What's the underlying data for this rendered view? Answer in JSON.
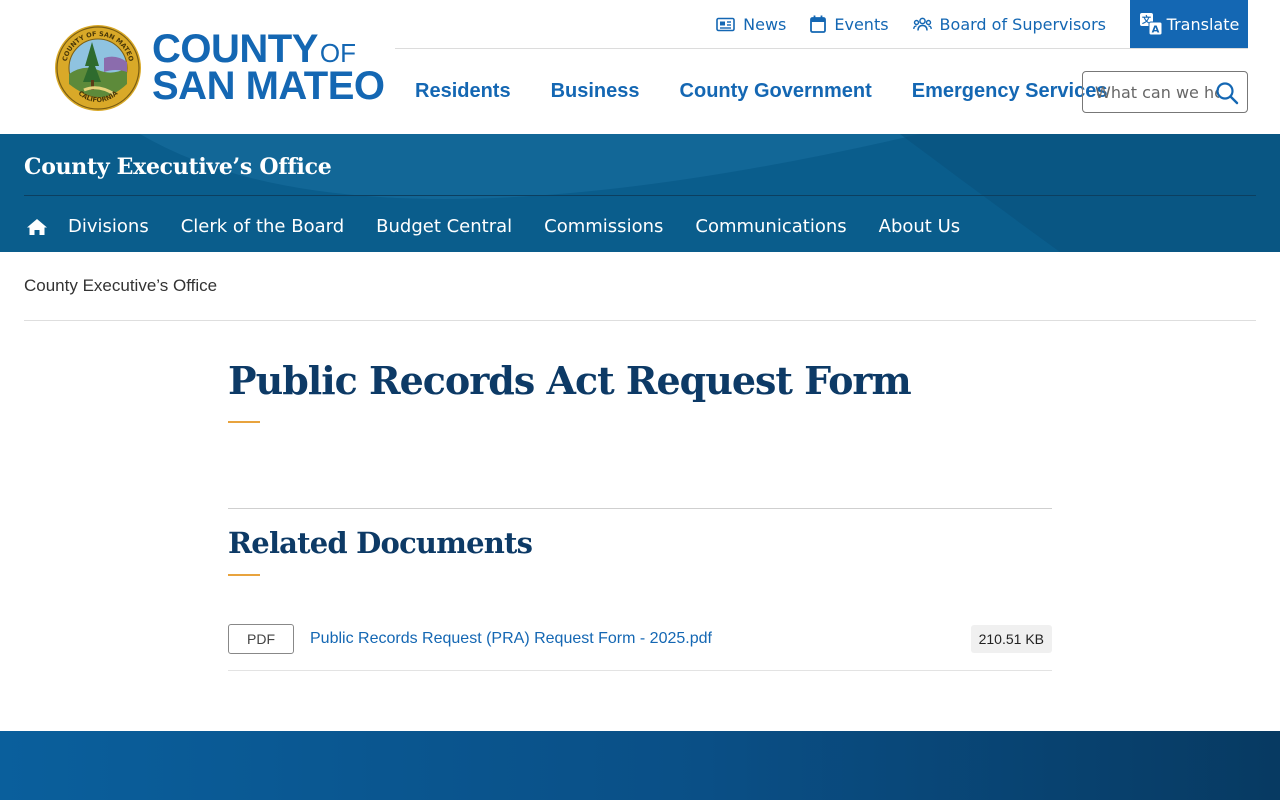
{
  "header": {
    "logo": {
      "line1": "COUNTY",
      "line1_suffix": "OF",
      "line2": "SAN MATEO",
      "seal_text_top": "COUNTY OF SAN MATEO",
      "seal_text_bottom": "CALIFORNIA"
    },
    "utility": {
      "news": "News",
      "events": "Events",
      "board": "Board of Supervisors",
      "translate": "Translate"
    },
    "nav": [
      "Residents",
      "Business",
      "County Government",
      "Emergency Services"
    ],
    "search": {
      "placeholder": "What can we help you find?"
    }
  },
  "department": {
    "title": "County Executive’s Office",
    "subnav": [
      "Divisions",
      "Clerk of the Board",
      "Budget Central",
      "Commissions",
      "Communications",
      "About Us"
    ]
  },
  "breadcrumb": "County Executive’s Office",
  "page": {
    "title": "Public Records Act Request Form",
    "related_title": "Related Documents",
    "documents": [
      {
        "type": "PDF",
        "name": "Public Records Request (PRA) Request Form - 2025.pdf",
        "size": "210.51 KB"
      }
    ]
  },
  "colors": {
    "brand_blue": "#1467b3",
    "dept_band": "#0a5d8c",
    "heading_navy": "#0d3a66",
    "accent_gold": "#e8a33d"
  }
}
